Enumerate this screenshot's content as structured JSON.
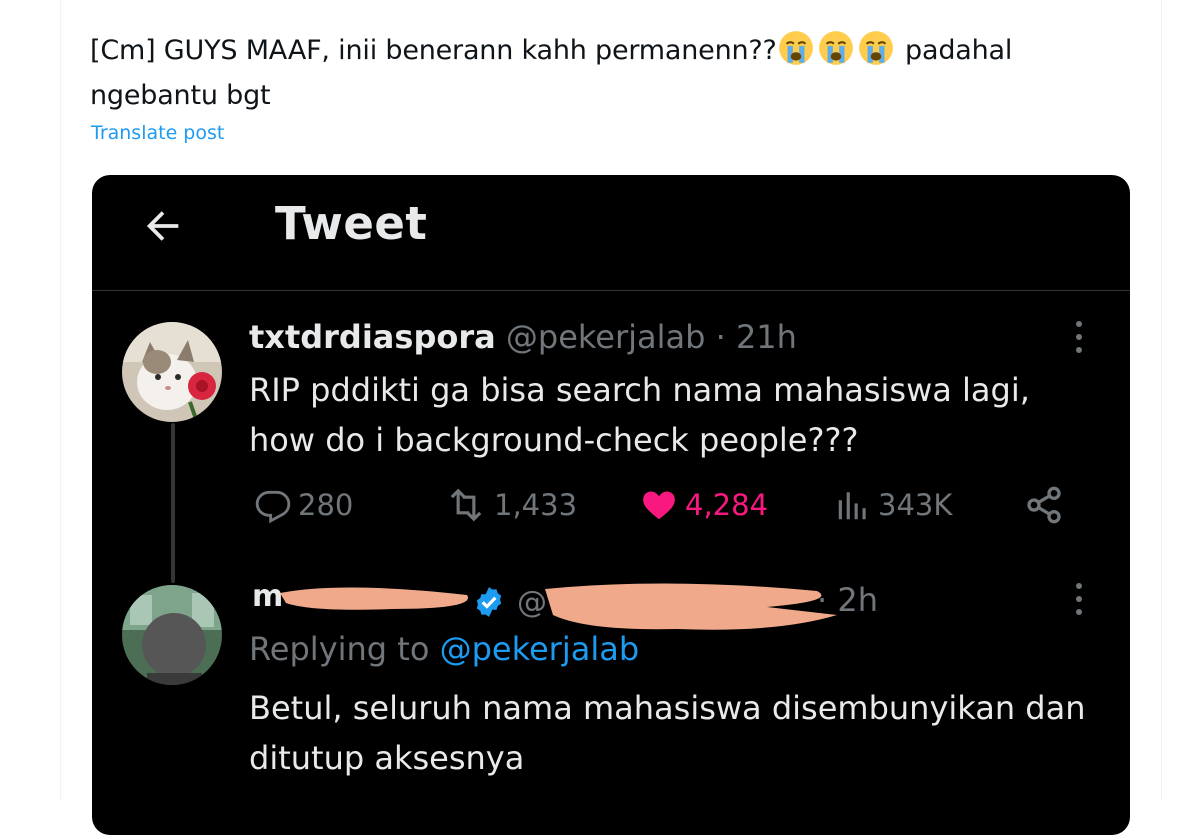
{
  "post": {
    "text_before_emoji": "[Cm] GUYS MAAF, inii benerann kahh permanenn??",
    "emojis": [
      "loudly-crying-face",
      "loudly-crying-face",
      "loudly-crying-face"
    ],
    "text_after_emoji": " padahal ngebantu bgt",
    "translate_label": "Translate post"
  },
  "embedded": {
    "header_title": "Tweet",
    "tweet1": {
      "display_name": "txtdrdiaspora",
      "handle": "@pekerjalab",
      "separator": " · ",
      "time": "21h",
      "body": "RIP pddikti ga bisa search nama mahasiswa lagi, how do i background-check people???",
      "replies": "280",
      "retweets": "1,433",
      "likes": "4,284",
      "views": "343K"
    },
    "tweet2": {
      "time": "· 2h",
      "replying_prefix": "Replying to ",
      "replying_to": "@pekerjalab",
      "body": "Betul, seluruh nama mahasiswa disembunyikan dan ditutup aksesnya"
    }
  },
  "colors": {
    "link": "#1d9bf0",
    "like": "#f91880",
    "muted": "#71767b",
    "dark_bg": "#000000",
    "redaction": "#f0a98a"
  }
}
